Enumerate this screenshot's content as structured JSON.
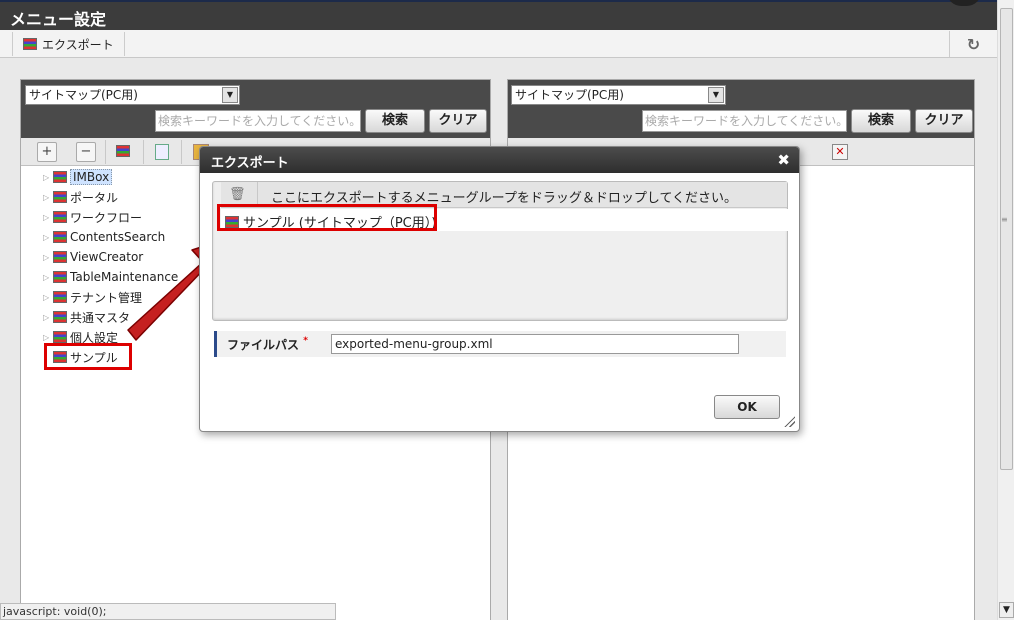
{
  "window": {
    "title": "メニュー設定"
  },
  "toolbar": {
    "export_label": "エクスポート",
    "refresh_icon": "refresh-icon"
  },
  "left_panel": {
    "sitemap_select": "サイトマップ(PC用)",
    "keyword_placeholder": "検索キーワードを入力してください。",
    "search_label": "検索",
    "clear_label": "クリア",
    "tree_items": [
      {
        "label": "IMBox"
      },
      {
        "label": "ポータル"
      },
      {
        "label": "ワークフロー"
      },
      {
        "label": "ContentsSearch"
      },
      {
        "label": "ViewCreator"
      },
      {
        "label": "TableMaintenance"
      },
      {
        "label": "テナント管理"
      },
      {
        "label": "共通マスタ"
      },
      {
        "label": "個人設定"
      },
      {
        "label": "サンプル"
      }
    ]
  },
  "right_panel": {
    "sitemap_select": "サイトマップ(PC用)",
    "keyword_placeholder": "検索キーワードを入力してください。",
    "search_label": "検索",
    "clear_label": "クリア"
  },
  "dialog": {
    "title": "エクスポート",
    "drop_message": "ここにエクスポートするメニューグループをドラッグ＆ドロップしてください。",
    "dropped_item": "サンプル (サイトマップ（PC用）)",
    "file_path_label": "ファイルパス",
    "file_path_required": "*",
    "file_path_value": "exported-menu-group.xml",
    "ok_label": "OK"
  },
  "status_bar": {
    "text": "javascript: void(0);"
  },
  "colors": {
    "header_bg": "#3c3c3c",
    "annotation_red": "#d00000",
    "panel_header": "#4a4a4a"
  }
}
